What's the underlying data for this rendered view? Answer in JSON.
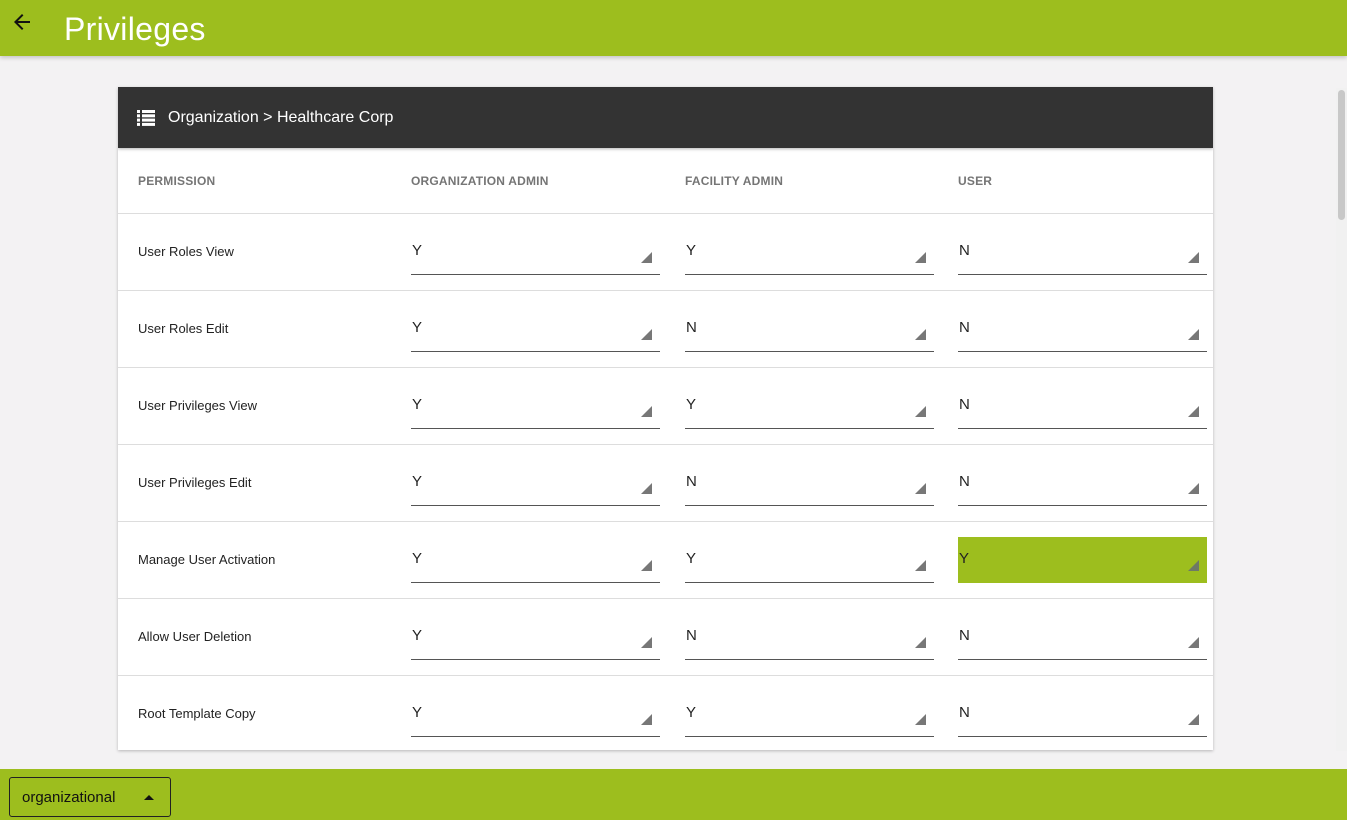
{
  "header": {
    "title": "Privileges",
    "back_icon": "arrow-left-icon"
  },
  "card": {
    "icon": "list-icon",
    "breadcrumb": "Organization > Healthcare Corp"
  },
  "table": {
    "columns": [
      "PERMISSION",
      "ORGANIZATION ADMIN",
      "FACILITY ADMIN",
      "USER"
    ],
    "rows": [
      {
        "permission": "User Roles View",
        "values": [
          "Y",
          "Y",
          "N"
        ]
      },
      {
        "permission": "User Roles Edit",
        "values": [
          "Y",
          "N",
          "N"
        ]
      },
      {
        "permission": "User Privileges View",
        "values": [
          "Y",
          "Y",
          "N"
        ]
      },
      {
        "permission": "User Privileges Edit",
        "values": [
          "Y",
          "N",
          "N"
        ]
      },
      {
        "permission": "Manage User Activation",
        "values": [
          "Y",
          "Y",
          "Y"
        ],
        "highlight": 2
      },
      {
        "permission": "Allow User Deletion",
        "values": [
          "Y",
          "N",
          "N"
        ]
      },
      {
        "permission": "Root Template Copy",
        "values": [
          "Y",
          "Y",
          "N"
        ]
      }
    ]
  },
  "footer": {
    "selector_value": "organizational",
    "selector_icon": "caret-up-icon"
  },
  "colors": {
    "accent": "#9dbe1e",
    "header_dark": "#333333"
  }
}
